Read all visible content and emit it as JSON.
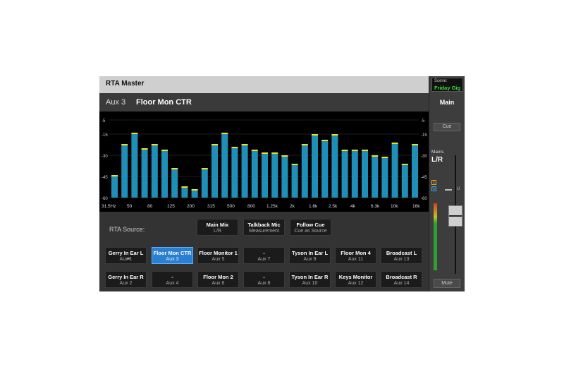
{
  "window": {
    "title": "RTA Master"
  },
  "channel": {
    "aux": "Aux 3",
    "name": "Floor Mon CTR"
  },
  "rta": {
    "db_labels": [
      "-5",
      "-15",
      "-30",
      "-45",
      "-60"
    ],
    "freq_labels": [
      "31.5Hz",
      "50",
      "80",
      "125",
      "200",
      "315",
      "500",
      "800",
      "1.25k",
      "2k",
      "1.6k",
      "2.5k",
      "4k",
      "6.3k",
      "10k",
      "16k"
    ],
    "bar_levels_db": [
      -45,
      -23,
      -15,
      -26,
      -23,
      -27,
      -40,
      -53,
      -55,
      -40,
      -23,
      -15,
      -25,
      -23,
      -27,
      -29,
      -29,
      -31,
      -37,
      -23,
      -16,
      -20,
      -16,
      -27,
      -27,
      -27,
      -31,
      -32,
      -22,
      -37,
      -23
    ],
    "bar_color": "#1f8fb8",
    "peak_color": "#f0e020"
  },
  "source": {
    "label": "RTA Source:",
    "top_buttons": [
      {
        "l1": "Main Mix",
        "l2": "L/R"
      },
      {
        "l1": "Talkback Mic",
        "l2": "Measurement"
      },
      {
        "l1": "Follow Cue",
        "l2": "Cue as Source"
      }
    ],
    "row1": [
      {
        "l1": "Gerry In Ear L",
        "l2": "Aux 1"
      },
      {
        "l1": "Floor Mon CTR",
        "l2": "Aux 3"
      },
      {
        "l1": "Floor Monitor 1",
        "l2": "Aux 5"
      },
      {
        "l1": "-",
        "l2": "Aux 7"
      },
      {
        "l1": "Tyson In Ear L",
        "l2": "Aux 9"
      },
      {
        "l1": "Floor Mon 4",
        "l2": "Aux 11"
      },
      {
        "l1": "Broadcast L",
        "l2": "Aux 13"
      }
    ],
    "row2": [
      {
        "l1": "Gerry In Ear R",
        "l2": "Aux 2"
      },
      {
        "l1": "-",
        "l2": "Aux 4"
      },
      {
        "l1": "Floor Mon 2",
        "l2": "Aux 6"
      },
      {
        "l1": "-",
        "l2": "Aux 8"
      },
      {
        "l1": "Tyson In Ear R",
        "l2": "Aux 10"
      },
      {
        "l1": "Keys Monitor",
        "l2": "Aux 12"
      },
      {
        "l1": "Broadcast R",
        "l2": "Aux 14"
      }
    ],
    "selected": "Floor Mon CTR",
    "link_icon": "link-icon",
    "accent": "#2a7fd0"
  },
  "strip": {
    "scene_label": "Scene:",
    "scene_name": "Friday Gig",
    "main_label": "Main",
    "cue_label": "Cue",
    "mains_label": "Mains",
    "lr_label": "L/R",
    "unity_mark": "U",
    "mute_label": "Mute",
    "badge1": "C",
    "badge2": "W"
  }
}
